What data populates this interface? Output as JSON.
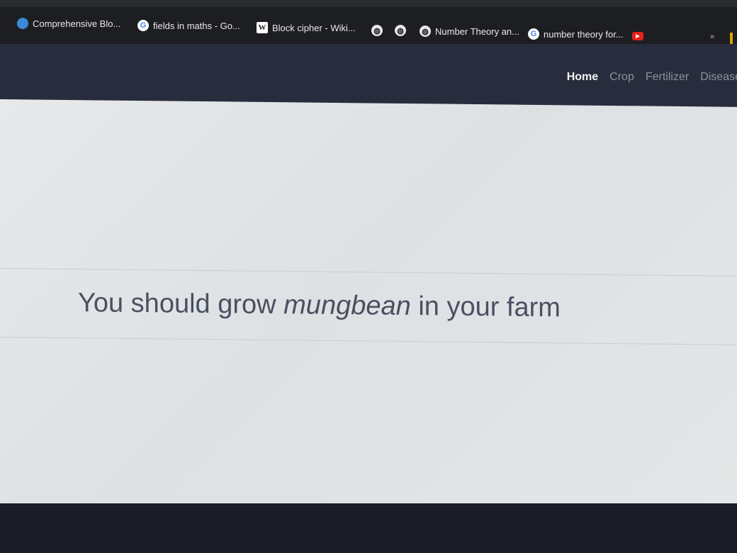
{
  "bookmarks": [
    {
      "icon": "blue-circle-icon",
      "label": "Comprehensive Blo..."
    },
    {
      "icon": "google-icon",
      "label": "fields in maths - Go..."
    },
    {
      "icon": "wikipedia-icon",
      "label": "Block cipher - Wiki..."
    },
    {
      "icon": "globe-icon",
      "label": ""
    },
    {
      "icon": "globe-icon",
      "label": ""
    },
    {
      "icon": "globe-icon",
      "label": "Number Theory an..."
    },
    {
      "icon": "google-icon",
      "label": "number theory for..."
    },
    {
      "icon": "youtube-icon",
      "label": ""
    }
  ],
  "bookmarks_overflow": "»",
  "navbar": {
    "links": [
      "Home",
      "Crop",
      "Fertilizer",
      "Disease"
    ],
    "active": "Home"
  },
  "result": {
    "prefix": "You should grow",
    "crop": "mungbean",
    "suffix": "in your farm"
  },
  "colors": {
    "navbar_bg": "#282d3d",
    "bookmarks_bg": "#1d1e22",
    "content_bg": "#e3e6e8",
    "result_text": "#4a5060"
  }
}
